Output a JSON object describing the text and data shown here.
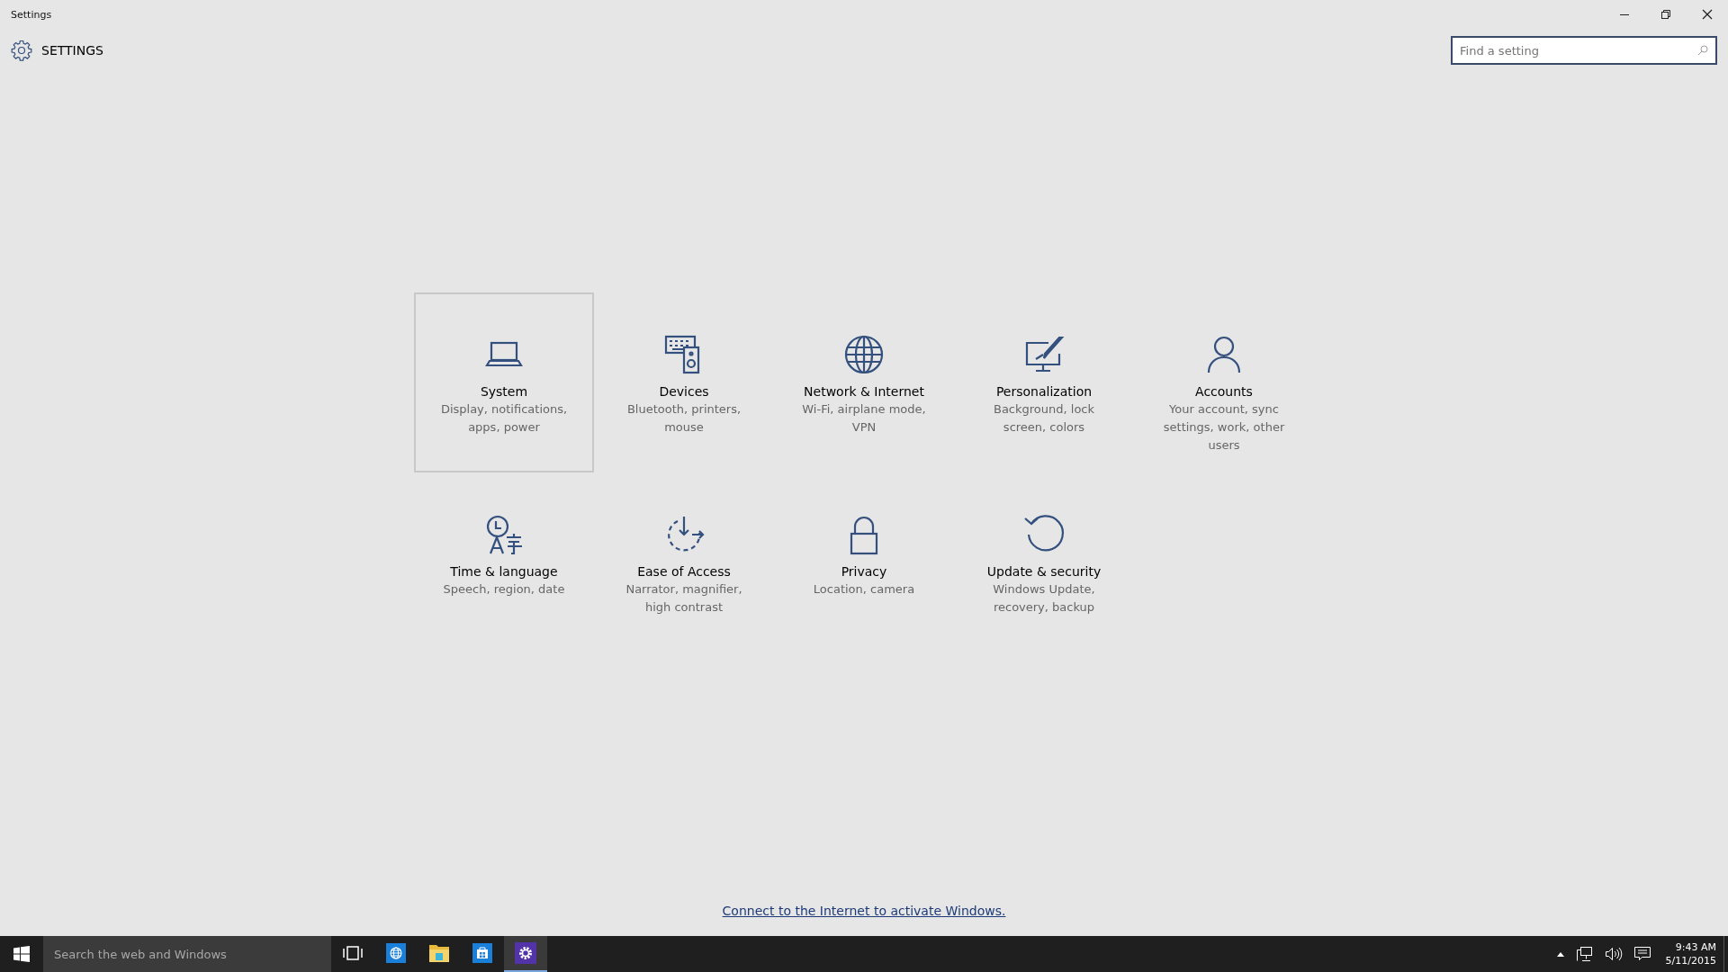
{
  "window": {
    "title": "Settings"
  },
  "header": {
    "title": "SETTINGS"
  },
  "search": {
    "placeholder": "Find a setting"
  },
  "categories": [
    {
      "title": "System",
      "description": "Display, notifications, apps, power",
      "selected": true
    },
    {
      "title": "Devices",
      "description": "Bluetooth, printers, mouse",
      "selected": false
    },
    {
      "title": "Network & Internet",
      "description": "Wi-Fi, airplane mode, VPN",
      "selected": false
    },
    {
      "title": "Personalization",
      "description": "Background, lock screen, colors",
      "selected": false
    },
    {
      "title": "Accounts",
      "description": "Your account, sync settings, work, other users",
      "selected": false
    },
    {
      "title": "Time & language",
      "description": "Speech, region, date",
      "selected": false
    },
    {
      "title": "Ease of Access",
      "description": "Narrator, magnifier, high contrast",
      "selected": false
    },
    {
      "title": "Privacy",
      "description": "Location, camera",
      "selected": false
    },
    {
      "title": "Update & security",
      "description": "Windows Update, recovery, backup",
      "selected": false
    }
  ],
  "activation_link": "Connect to the Internet to activate Windows.",
  "taskbar": {
    "search_placeholder": "Search the web and Windows",
    "apps": [
      {
        "selected": false
      },
      {
        "selected": false
      },
      {
        "selected": false
      },
      {
        "selected": false
      },
      {
        "selected": true
      }
    ],
    "time": "9:43 AM",
    "date": "5/11/2015"
  }
}
